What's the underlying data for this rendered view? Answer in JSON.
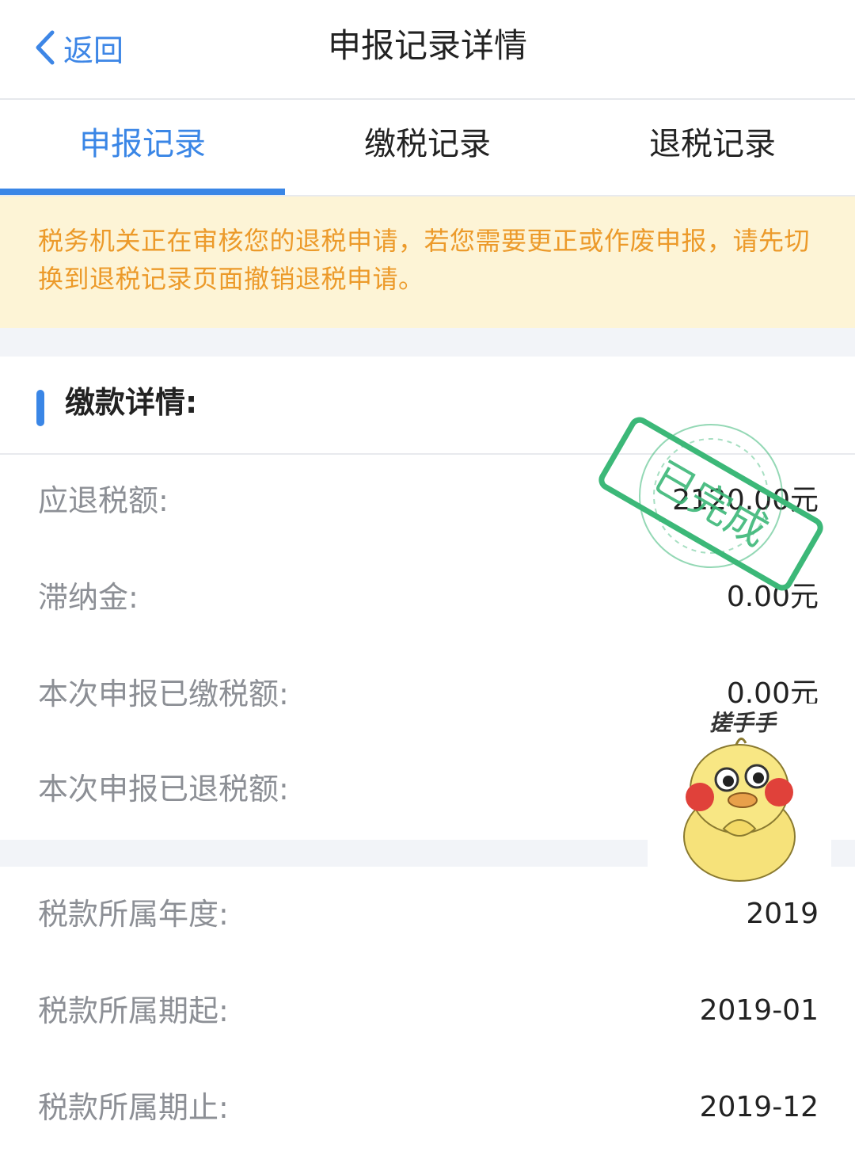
{
  "nav": {
    "back_label": "返回",
    "title": "申报记录详情"
  },
  "tabs": [
    {
      "label": "申报记录",
      "active": true
    },
    {
      "label": "缴税记录",
      "active": false
    },
    {
      "label": "退税记录",
      "active": false
    }
  ],
  "notice": {
    "text": "税务机关正在审核您的退税申请，若您需要更正或作废申报，请先切换到退税记录页面撤销退税申请。"
  },
  "section": {
    "title": "缴款详情:"
  },
  "details": [
    {
      "label": "应退税额:",
      "value": "2120.00元"
    },
    {
      "label": "滞纳金:",
      "value": "0.00元"
    },
    {
      "label": "本次申报已缴税额:",
      "value": "0.00元"
    },
    {
      "label": "本次申报已退税额:",
      "value": ""
    }
  ],
  "period": [
    {
      "label": "税款所属年度:",
      "value": "2019"
    },
    {
      "label": "税款所属期起:",
      "value": "2019-01"
    },
    {
      "label": "税款所属期止:",
      "value": "2019-12"
    }
  ],
  "stamp": {
    "text": "已完成",
    "color": "#3cb878"
  },
  "sticker": {
    "caption": "搓手手"
  },
  "colors": {
    "accent": "#3a86e6",
    "notice_bg": "#fdf4d6",
    "notice_text": "#ec9a2a"
  }
}
